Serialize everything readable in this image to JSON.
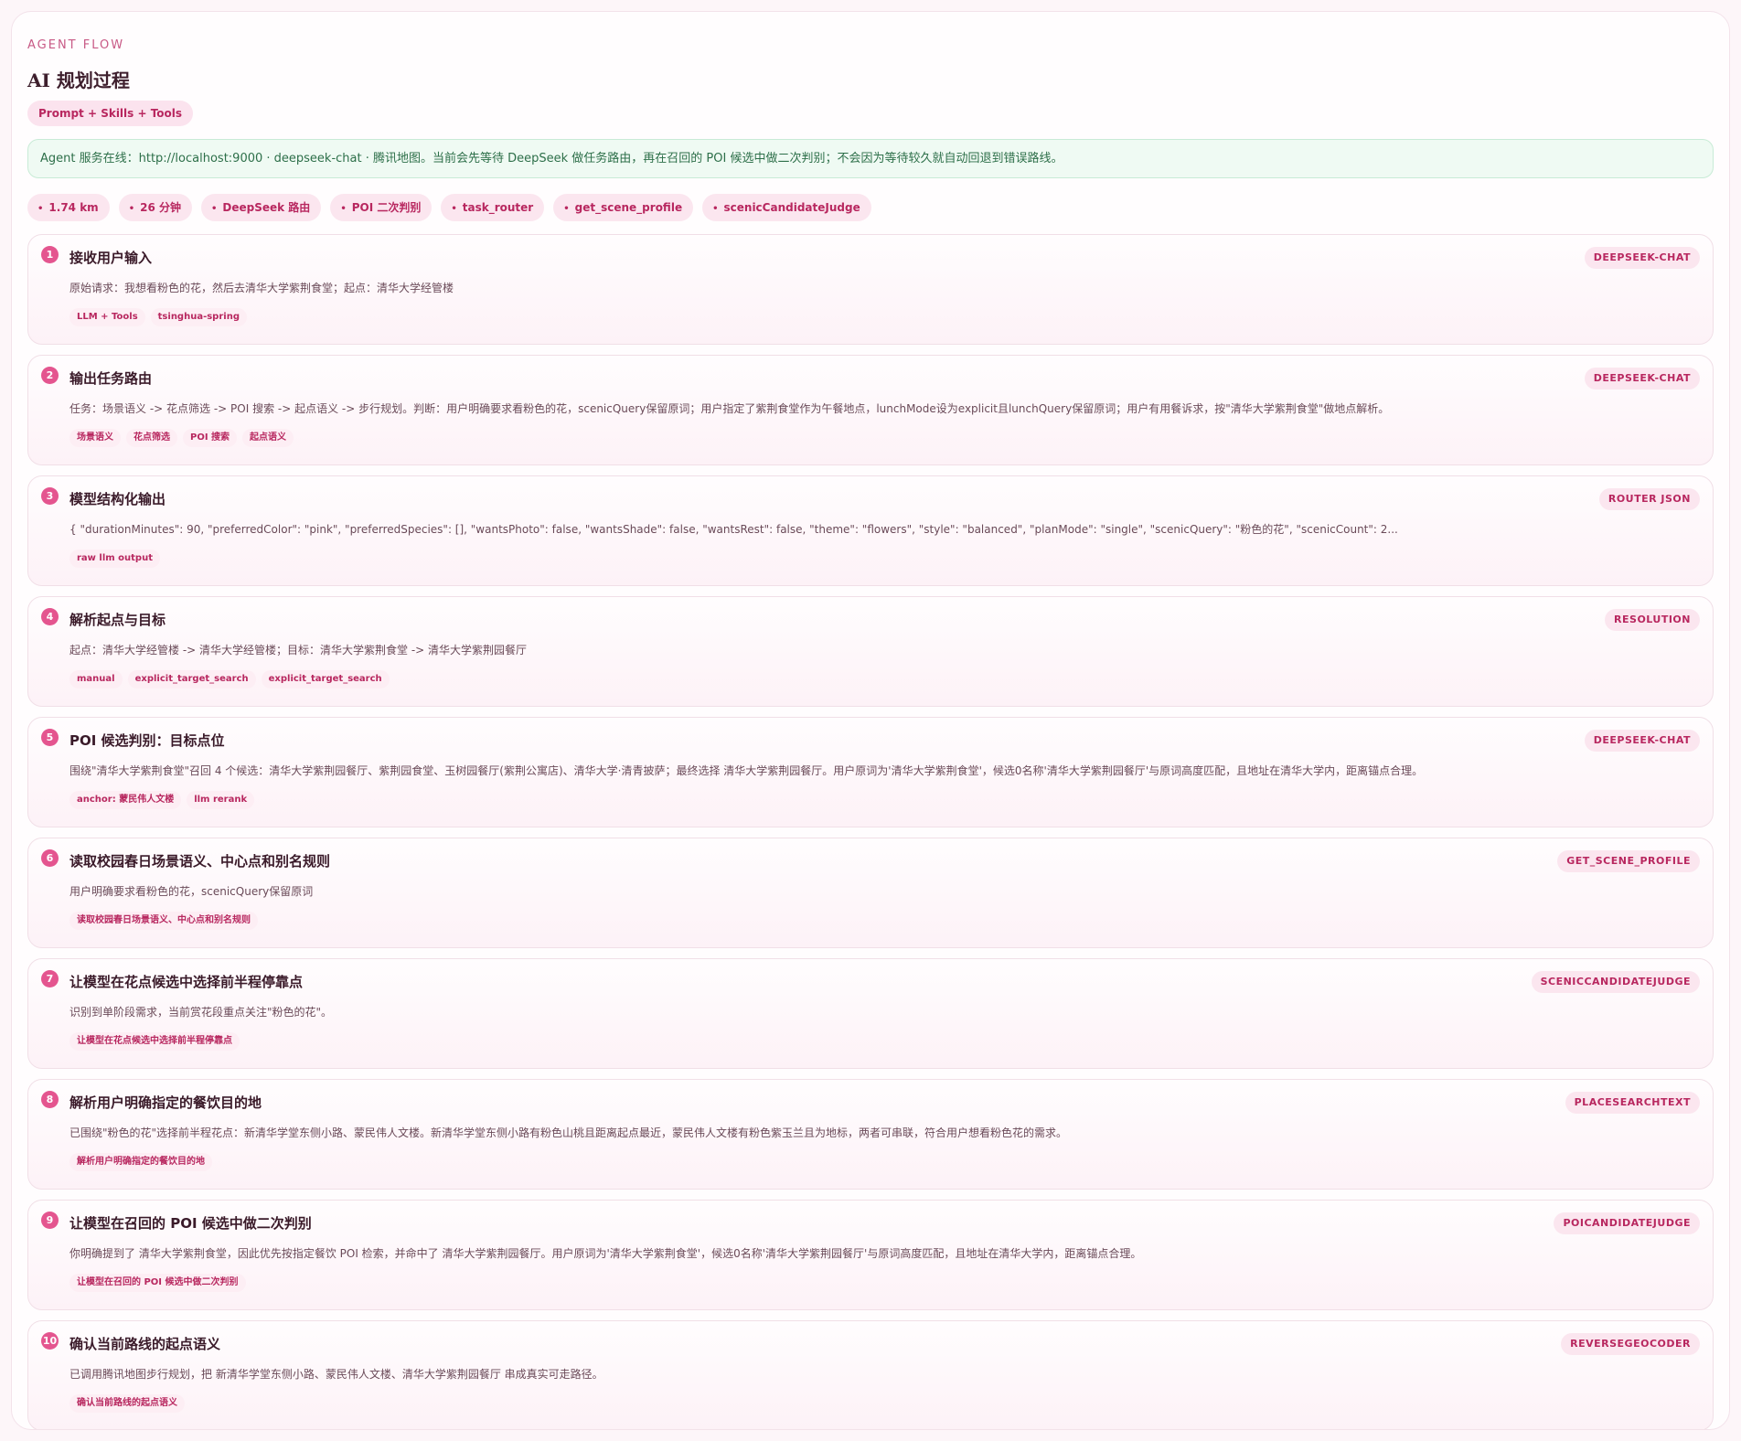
{
  "header": {
    "kicker": "AGENT FLOW",
    "title": "AI 规划过程",
    "badge": "Prompt + Skills + Tools"
  },
  "status": {
    "text": "Agent 服务在线：http://localhost:9000 · deepseek-chat · 腾讯地图。当前会先等待 DeepSeek 做任务路由，再在召回的 POI 候选中做二次判别；不会因为等待较久就自动回退到错误路线。"
  },
  "chips": [
    "1.74 km",
    "26 分钟",
    "DeepSeek 路由",
    "POI 二次判别",
    "task_router",
    "get_scene_profile",
    "scenicCandidateJudge"
  ],
  "steps": [
    {
      "num": "1",
      "title": "接收用户输入",
      "tag": "DEEPSEEK-CHAT",
      "desc": "原始请求：我想看粉色的花，然后去清华大学紫荆食堂；起点：清华大学经管楼",
      "tags": [
        "LLM + Tools",
        "tsinghua-spring"
      ]
    },
    {
      "num": "2",
      "title": "输出任务路由",
      "tag": "DEEPSEEK-CHAT",
      "desc": "任务：场景语义 -> 花点筛选 -> POI 搜索 -> 起点语义 -> 步行规划。判断：用户明确要求看粉色的花，scenicQuery保留原词；用户指定了紫荆食堂作为午餐地点，lunchMode设为explicit且lunchQuery保留原词；用户有用餐诉求，按\"清华大学紫荆食堂\"做地点解析。",
      "tags": [
        "场景语义",
        "花点筛选",
        "POI 搜索",
        "起点语义"
      ]
    },
    {
      "num": "3",
      "title": "模型结构化输出",
      "tag": "ROUTER JSON",
      "desc": "{ \"durationMinutes\": 90, \"preferredColor\": \"pink\", \"preferredSpecies\": [], \"wantsPhoto\": false, \"wantsShade\": false, \"wantsRest\": false, \"theme\": \"flowers\", \"style\": \"balanced\", \"planMode\": \"single\", \"scenicQuery\": \"粉色的花\", \"scenicCount\": 2...",
      "tags": [
        "raw llm output"
      ]
    },
    {
      "num": "4",
      "title": "解析起点与目标",
      "tag": "RESOLUTION",
      "desc": "起点：清华大学经管楼 -> 清华大学经管楼；目标：清华大学紫荆食堂 -> 清华大学紫荆园餐厅",
      "tags": [
        "manual",
        "explicit_target_search",
        "explicit_target_search"
      ]
    },
    {
      "num": "5",
      "title": "POI 候选判别：目标点位",
      "tag": "DEEPSEEK-CHAT",
      "desc": "围绕\"清华大学紫荆食堂\"召回 4 个候选：清华大学紫荆园餐厅、紫荆园食堂、玉树园餐厅(紫荆公寓店)、清华大学·清青披萨；最终选择 清华大学紫荆园餐厅。用户原词为'清华大学紫荆食堂'，候选0名称'清华大学紫荆园餐厅'与原词高度匹配，且地址在清华大学内，距离锚点合理。",
      "tags": [
        "anchor: 蒙民伟人文楼",
        "llm rerank"
      ]
    },
    {
      "num": "6",
      "title": "读取校园春日场景语义、中心点和别名规则",
      "tag": "GET_SCENE_PROFILE",
      "desc": "用户明确要求看粉色的花，scenicQuery保留原词",
      "tags": [
        "读取校园春日场景语义、中心点和别名规则"
      ]
    },
    {
      "num": "7",
      "title": "让模型在花点候选中选择前半程停靠点",
      "tag": "SCENICCANDIDATEJUDGE",
      "desc": "识别到单阶段需求，当前赏花段重点关注\"粉色的花\"。",
      "tags": [
        "让模型在花点候选中选择前半程停靠点"
      ]
    },
    {
      "num": "8",
      "title": "解析用户明确指定的餐饮目的地",
      "tag": "PLACESEARCHTEXT",
      "desc": "已围绕\"粉色的花\"选择前半程花点：新清华学堂东侧小路、蒙民伟人文楼。新清华学堂东侧小路有粉色山桃且距离起点最近，蒙民伟人文楼有粉色紫玉兰且为地标，两者可串联，符合用户想看粉色花的需求。",
      "tags": [
        "解析用户明确指定的餐饮目的地"
      ]
    },
    {
      "num": "9",
      "title": "让模型在召回的 POI 候选中做二次判别",
      "tag": "POICANDIDATEJUDGE",
      "desc": "你明确提到了 清华大学紫荆食堂，因此优先按指定餐饮 POI 检索，并命中了 清华大学紫荆园餐厅。用户原词为'清华大学紫荆食堂'，候选0名称'清华大学紫荆园餐厅'与原词高度匹配，且地址在清华大学内，距离锚点合理。",
      "tags": [
        "让模型在召回的 POI 候选中做二次判别"
      ]
    },
    {
      "num": "10",
      "title": "确认当前路线的起点语义",
      "tag": "REVERSEGEOCODER",
      "desc": "已调用腾讯地图步行规划，把 新清华学堂东侧小路、蒙民伟人文楼、清华大学紫荆园餐厅 串成真实可走路径。",
      "tags": [
        "确认当前路线的起点语义"
      ]
    }
  ]
}
